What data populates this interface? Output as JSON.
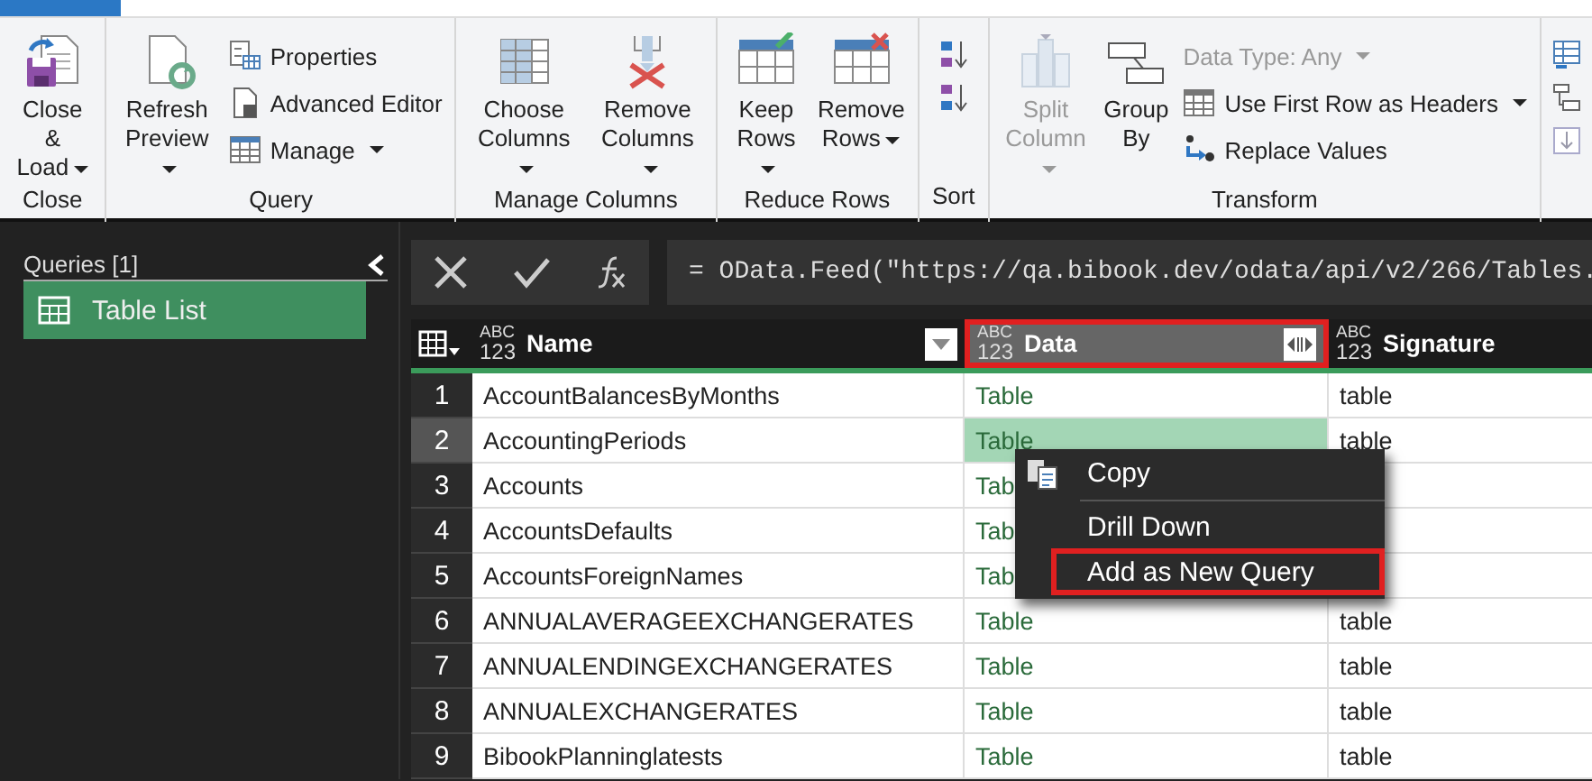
{
  "ribbon": {
    "groups": [
      {
        "label": "Close",
        "items": [
          {
            "kind": "large",
            "lines": [
              "Close &",
              "Load"
            ],
            "dropdown": true,
            "disabled": false
          }
        ]
      },
      {
        "label": "Query",
        "items": [
          {
            "kind": "large",
            "lines": [
              "Refresh",
              "Preview"
            ],
            "dropdown": true,
            "disabled": false
          },
          {
            "kind": "stack",
            "items": [
              {
                "label": "Properties",
                "dropdown": false,
                "disabled": false,
                "icon": true
              },
              {
                "label": "Advanced Editor",
                "dropdown": false,
                "disabled": false,
                "icon": true
              },
              {
                "label": "Manage",
                "dropdown": true,
                "disabled": false,
                "icon": true
              }
            ]
          }
        ]
      },
      {
        "label": "Manage Columns",
        "items": [
          {
            "kind": "large",
            "lines": [
              "Choose",
              "Columns"
            ],
            "dropdown": true,
            "disabled": false
          },
          {
            "kind": "large",
            "lines": [
              "Remove",
              "Columns"
            ],
            "dropdown": true,
            "disabled": false
          }
        ]
      },
      {
        "label": "Reduce Rows",
        "items": [
          {
            "kind": "large",
            "lines": [
              "Keep",
              "Rows"
            ],
            "dropdown": true,
            "disabled": false
          },
          {
            "kind": "large",
            "lines": [
              "Remove",
              "Rows"
            ],
            "dropdown": true,
            "disabled": false
          }
        ]
      },
      {
        "label": "Sort",
        "items": [
          {
            "kind": "icons"
          }
        ]
      },
      {
        "label": "Transform",
        "items": [
          {
            "kind": "large",
            "lines": [
              "Split",
              "Column"
            ],
            "dropdown": true,
            "disabled": true
          },
          {
            "kind": "large",
            "lines": [
              "Group",
              "By"
            ],
            "dropdown": false,
            "disabled": false
          },
          {
            "kind": "stack",
            "items": [
              {
                "label": "Data Type: Any",
                "dropdown": true,
                "disabled": true,
                "icon": false
              },
              {
                "label": "Use First Row as Headers",
                "dropdown": true,
                "disabled": false,
                "icon": true
              },
              {
                "label": "Replace Values",
                "dropdown": false,
                "disabled": false,
                "icon": true
              }
            ]
          }
        ]
      }
    ]
  },
  "sidebar": {
    "title": "Queries [1]",
    "items": [
      {
        "label": "Table List",
        "selected": true
      }
    ]
  },
  "formula": "= OData.Feed(\"https://qa.bibook.dev/odata/api/v2/266/Tables.",
  "table": {
    "columns": [
      {
        "type": [
          "ABC",
          "123"
        ],
        "name": "Name",
        "selected": false,
        "annotated": false
      },
      {
        "type": [
          "ABC",
          "123"
        ],
        "name": "Data",
        "selected": true,
        "annotated": true
      },
      {
        "type": [
          "ABC",
          "123"
        ],
        "name": "Signature",
        "selected": false,
        "annotated": false
      }
    ],
    "rows": [
      {
        "number": "1",
        "name": "AccountBalancesByMonths",
        "data": "Table",
        "signature": "table",
        "selected": false
      },
      {
        "number": "2",
        "name": "AccountingPeriods",
        "data": "Table",
        "signature": "table",
        "selected": true
      },
      {
        "number": "3",
        "name": "Accounts",
        "data": "Tab",
        "selected": false
      },
      {
        "number": "4",
        "name": "AccountsDefaults",
        "data": "Tab",
        "selected": false
      },
      {
        "number": "5",
        "name": "AccountsForeignNames",
        "data": "Tab",
        "selected": false
      },
      {
        "number": "6",
        "name": "ANNUALAVERAGEEXCHANGERATES",
        "data": "Table",
        "signature": "table",
        "selected": false
      },
      {
        "number": "7",
        "name": "ANNUALENDINGEXCHANGERATES",
        "data": "Table",
        "signature": "table",
        "selected": false
      },
      {
        "number": "8",
        "name": "ANNUALEXCHANGERATES",
        "data": "Table",
        "signature": "table",
        "selected": false
      },
      {
        "number": "9",
        "name": "BibookPlanninglatests",
        "data": "Table",
        "signature": "table",
        "selected": false
      }
    ]
  },
  "context_menu": {
    "items": [
      {
        "kind": "item",
        "label": "Copy",
        "icon": true,
        "annotated": false
      },
      {
        "kind": "separator"
      },
      {
        "kind": "item",
        "label": "Drill Down",
        "icon": false,
        "annotated": false
      },
      {
        "kind": "item",
        "label": "Add as New Query",
        "icon": false,
        "annotated": true
      }
    ]
  }
}
